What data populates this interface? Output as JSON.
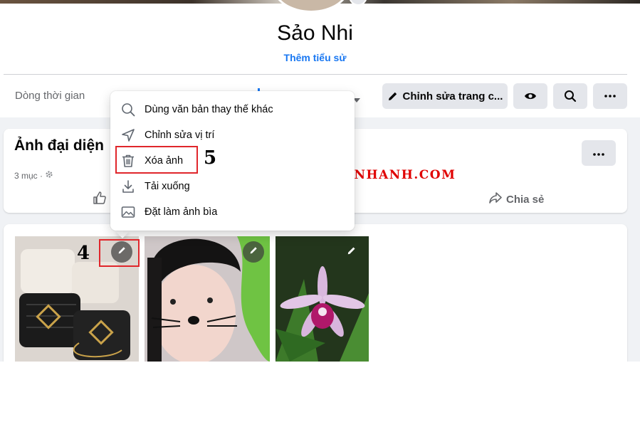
{
  "profile": {
    "name": "Sảo Nhi",
    "bio_link": "Thêm tiểu sử"
  },
  "nav": {
    "timeline_tab": "Dòng thời gian",
    "edit_profile_label": "Chỉnh sửa trang c...",
    "view_as_icon": "eye-icon",
    "search_icon": "search-icon",
    "more_icon": "more-icon"
  },
  "album": {
    "title": "Ảnh đại diện",
    "meta": "3 mục ·",
    "share_label": "Chia sẻ"
  },
  "context_menu": {
    "items": [
      {
        "label": "Dùng văn bản thay thế khác",
        "icon": "search-icon"
      },
      {
        "label": "Chỉnh sửa vị trí",
        "icon": "location-arrow-icon"
      },
      {
        "label": "Xóa ảnh",
        "icon": "trash-icon"
      },
      {
        "label": "Tải xuống",
        "icon": "download-icon"
      },
      {
        "label": "Đặt làm ảnh bìa",
        "icon": "image-icon"
      }
    ]
  },
  "annotations": {
    "step4": "4",
    "step5": "5",
    "watermark": "THUTHUATNHANH.COM"
  },
  "colors": {
    "accent": "#1877f2",
    "highlight_box": "#e0262b",
    "watermark": "#e00000",
    "page_bg": "#f0f2f5"
  }
}
